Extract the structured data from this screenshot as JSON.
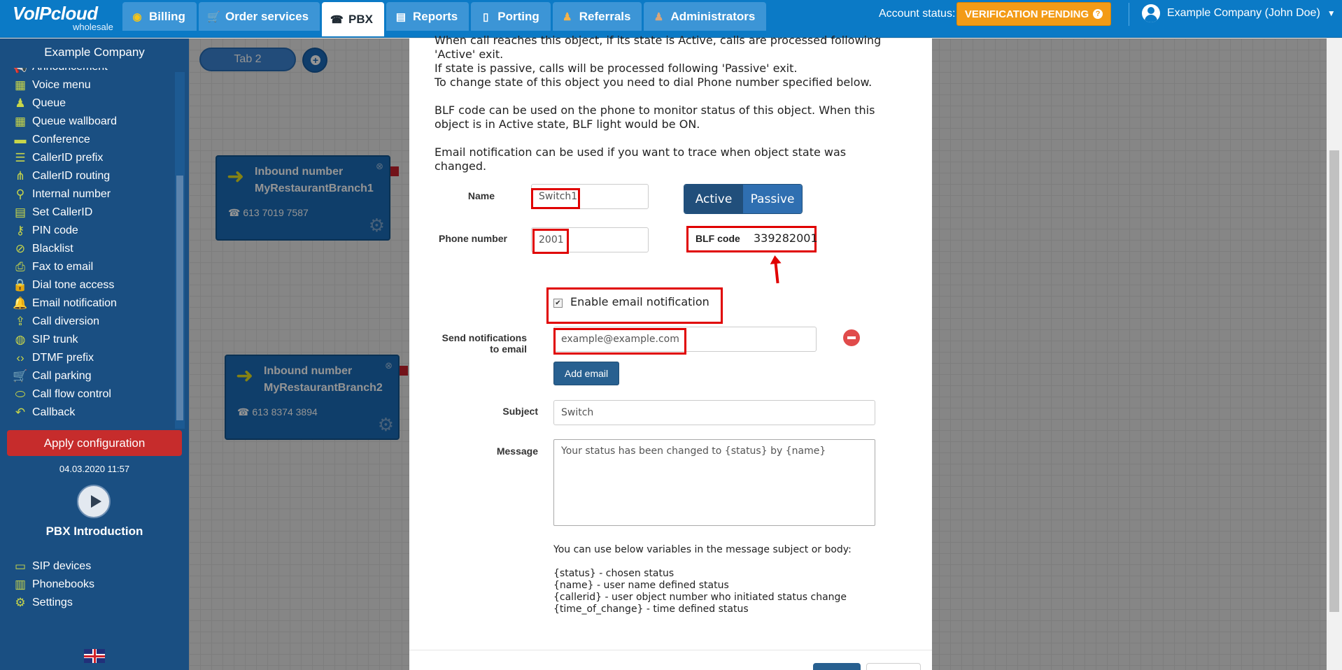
{
  "app": {
    "logo": "VoIPcloud",
    "logo_sub": "wholesale"
  },
  "nav": {
    "tabs": [
      {
        "label": "Billing",
        "icon": "coins-icon"
      },
      {
        "label": "Order services",
        "icon": "cart-icon"
      },
      {
        "label": "PBX",
        "icon": "pbx-icon"
      },
      {
        "label": "Reports",
        "icon": "report-icon"
      },
      {
        "label": "Porting",
        "icon": "phone-icon"
      },
      {
        "label": "Referrals",
        "icon": "person-icon"
      },
      {
        "label": "Administrators",
        "icon": "admin-icon"
      }
    ],
    "active_tab": "PBX",
    "account_status_label": "Account status:",
    "account_status_value": "VERIFICATION PENDING",
    "user_name": "Example Company (John Doe)"
  },
  "sidebar": {
    "company": "Example Company",
    "items": [
      {
        "label": "Announcement",
        "icon": "megaphone-icon"
      },
      {
        "label": "Voice menu",
        "icon": "grid-icon"
      },
      {
        "label": "Queue",
        "icon": "user-plus-icon"
      },
      {
        "label": "Queue wallboard",
        "icon": "table-icon"
      },
      {
        "label": "Conference",
        "icon": "conference-icon"
      },
      {
        "label": "CallerID prefix",
        "icon": "list-icon"
      },
      {
        "label": "CallerID routing",
        "icon": "sitemap-icon"
      },
      {
        "label": "Internal number",
        "icon": "pin-icon"
      },
      {
        "label": "Set CallerID",
        "icon": "id-card-icon"
      },
      {
        "label": "PIN code",
        "icon": "key-icon"
      },
      {
        "label": "Blacklist",
        "icon": "ban-icon"
      },
      {
        "label": "Fax to email",
        "icon": "fax-icon"
      },
      {
        "label": "Dial tone access",
        "icon": "lock-icon"
      },
      {
        "label": "Email notification",
        "icon": "bell-icon"
      },
      {
        "label": "Call diversion",
        "icon": "upload-icon"
      },
      {
        "label": "SIP trunk",
        "icon": "globe-icon"
      },
      {
        "label": "DTMF prefix",
        "icon": "code-icon"
      },
      {
        "label": "Call parking",
        "icon": "cart-icon"
      },
      {
        "label": "Call flow control",
        "icon": "toggle-icon"
      },
      {
        "label": "Callback",
        "icon": "reply-icon"
      }
    ],
    "apply_label": "Apply configuration",
    "apply_date": "04.03.2020 11:57",
    "intro_label": "PBX Introduction",
    "bottom_items": [
      {
        "label": "SIP devices",
        "icon": "monitor-icon"
      },
      {
        "label": "Phonebooks",
        "icon": "book-icon"
      },
      {
        "label": "Settings",
        "icon": "gear-icon"
      }
    ]
  },
  "canvas": {
    "tab_label": "Tab 2",
    "nodes": [
      {
        "type": "Inbound number",
        "name": "MyRestaurantBranch1",
        "phone": "613 7019 7587"
      },
      {
        "type": "Inbound number",
        "name": "MyRestaurantBranch2",
        "phone": "613 8374 3894"
      }
    ]
  },
  "modal": {
    "desc": [
      "When call reaches this object, if its state is Active, calls are processed following 'Active' exit.",
      "If state is passive, calls will be processed following 'Passive' exit.",
      "To change state of this object you need to dial Phone number specified below.",
      "BLF code can be used on the phone to monitor status of this object. When this object is in Active state, BLF light would be ON.",
      "Email notification can be used if you want to trace when object state was changed."
    ],
    "name_label": "Name",
    "name_value": "Switch1",
    "phone_label": "Phone number",
    "phone_value": "2001",
    "state_active": "Active",
    "state_passive": "Passive",
    "blf_label": "BLF code",
    "blf_value": "339282001",
    "email_enable_label": "Enable email notification",
    "send_label_1": "Send notifications",
    "send_label_2": "to email",
    "email_placeholder": "example@example.com",
    "add_email_label": "Add email",
    "subject_label": "Subject",
    "subject_value": "Switch",
    "message_label": "Message",
    "message_value": "Your status has been changed to {status} by {name}",
    "vars_hint": "You can use below variables in the message subject or body:",
    "vars": [
      "{status} - chosen status",
      "{name} - user name defined status",
      "{callerid} - user object number who initiated status change",
      "{time_of_change} - time defined status"
    ]
  }
}
